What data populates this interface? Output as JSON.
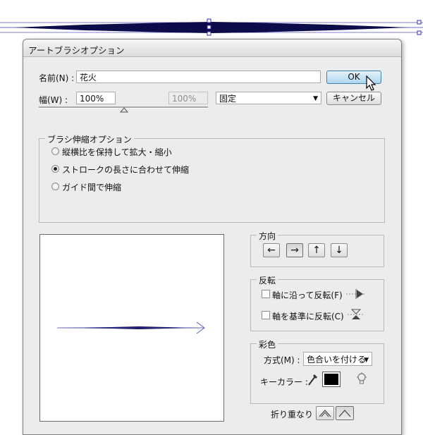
{
  "dialog": {
    "title": "アートブラシオプション",
    "name_label": "名前(N) :",
    "name_value": "花火",
    "width_label": "幅(W) :",
    "width_value": "100%",
    "width_secondary_value": "100%",
    "width_mode": "固定",
    "ok_label": "OK",
    "cancel_label": "キャンセル",
    "width_slider_percent": 100
  },
  "brush_scale": {
    "title": "ブラシ伸縮オプション",
    "options": [
      {
        "label": "縦横比を保持して拡大・縮小",
        "selected": false
      },
      {
        "label": "ストロークの長さに合わせて伸縮",
        "selected": true
      },
      {
        "label": "ガイド間で伸縮",
        "selected": false
      }
    ]
  },
  "direction": {
    "title": "方向",
    "buttons": [
      {
        "icon": "arrow-left-icon",
        "glyph": "←",
        "selected": false
      },
      {
        "icon": "arrow-right-icon",
        "glyph": "→",
        "selected": true
      },
      {
        "icon": "arrow-up-icon",
        "glyph": "↑",
        "selected": false
      },
      {
        "icon": "arrow-down-icon",
        "glyph": "↓",
        "selected": false
      }
    ]
  },
  "flip": {
    "title": "反転",
    "along_label": "軸に沿って反転(F)",
    "across_label": "軸を基準に反転(C)",
    "along_checked": false,
    "across_checked": false
  },
  "colorization": {
    "title": "彩色",
    "method_label": "方式(M) :",
    "method_value": "色合いを付ける",
    "key_color_label": "キーカラー :",
    "key_color": "#000000"
  },
  "overlap": {
    "label": "折り重なり :"
  },
  "colors": {
    "stroke": "#10105a",
    "accent": "#3c7fb1"
  }
}
